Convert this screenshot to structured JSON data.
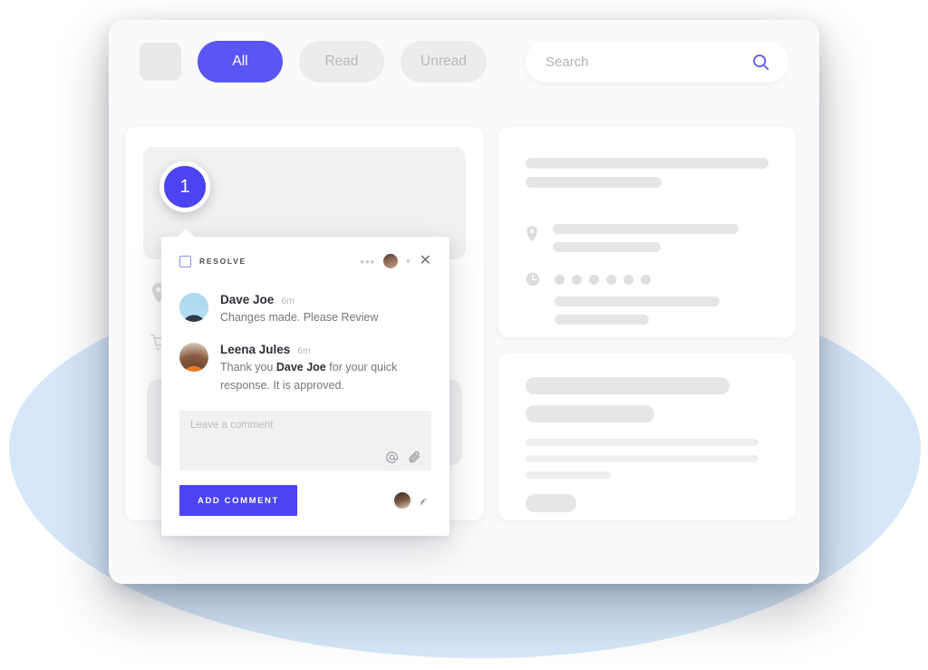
{
  "background": {
    "blob_color": "#d5e7f9",
    "page_color": "#ffffff"
  },
  "window": {
    "surface_color": "#fafafb"
  },
  "toolbar": {
    "logo_placeholder": "",
    "filters": [
      {
        "label": "All",
        "state": "active"
      },
      {
        "label": "Read",
        "state": "idle"
      },
      {
        "label": "Unread",
        "state": "idle"
      }
    ],
    "search": {
      "placeholder": "Search",
      "value": "",
      "icon": "search-icon",
      "icon_color": "#5a55f5"
    }
  },
  "marker": {
    "number": "1",
    "color": "#4b44f0"
  },
  "left_card": {
    "icons": [
      "location-pin-icon",
      "shopping-cart-icon"
    ]
  },
  "right_top_card": {
    "icons": [
      "location-pin-icon",
      "clock-icon"
    ],
    "dot_count": 6
  },
  "right_bottom_card": {
    "line_count": 6
  },
  "popup": {
    "resolve_label": "RESOLVE",
    "menu_icon": "more-options-icon",
    "avatar_icon": "assignee-avatar",
    "chevron_icon": "chevron-down-icon",
    "close_icon": "close-icon",
    "comments": [
      {
        "author": "Dave Joe",
        "time": "6m",
        "text_plain": "Changes made. Please Review",
        "text_pre": "Changes made. Please Review",
        "text_bold": "",
        "text_post": "",
        "avatar": "dave-joe-avatar"
      },
      {
        "author": "Leena Jules",
        "time": "6m",
        "text_plain": "Thank you Dave Joe for your quick response. It is approved.",
        "text_pre": "Thank you ",
        "text_bold": "Dave Joe",
        "text_post": " for your quick response. It is approved.",
        "avatar": "leena-jules-avatar"
      }
    ],
    "composer": {
      "placeholder": "Leave a comment",
      "value": "",
      "mention_icon": "at-mention-icon",
      "attach_icon": "paperclip-icon"
    },
    "footer": {
      "submit_label": "ADD COMMENT",
      "submit_color": "#4b44f0",
      "avatar_icon": "current-user-avatar",
      "subscribe_icon": "broadcast-icon"
    }
  }
}
